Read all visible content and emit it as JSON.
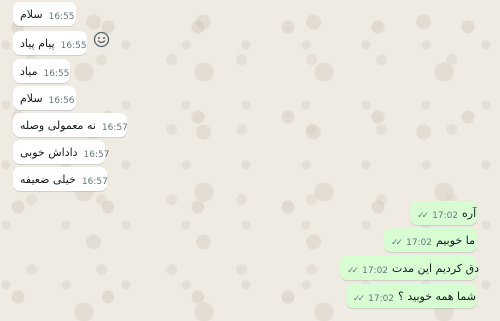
{
  "incoming_messages": [
    {
      "text": "سلام",
      "time": "16:55"
    },
    {
      "text": "پیام پیاد",
      "time": "16:55"
    },
    {
      "text": "میاد",
      "time": "16:55"
    },
    {
      "text": "سلام",
      "time": "16:56"
    },
    {
      "text": "نه معمولی وصله",
      "time": "16:57"
    },
    {
      "text": "داداش خوبی",
      "time": "16:57"
    },
    {
      "text": "خیلی ضعیفه",
      "time": "16:57"
    }
  ],
  "outgoing_messages": [
    {
      "text": "آره",
      "time": "17:02",
      "status": "read"
    },
    {
      "text": "ما خوبیم",
      "time": "17:02",
      "status": "read"
    },
    {
      "text": "دق کردیم این مدت",
      "time": "17:02",
      "status": "read"
    },
    {
      "text": "شما همه خوبید ؟",
      "time": "17:02",
      "status": "read"
    }
  ],
  "colors": {
    "incoming_bubble": "#ffffff",
    "outgoing_bubble": "#d9fdd3",
    "background": "#efeae2",
    "meta_text": "#667781"
  },
  "icons": {
    "reaction": "smiley-face-icon",
    "read_receipt": "double-check-icon"
  }
}
